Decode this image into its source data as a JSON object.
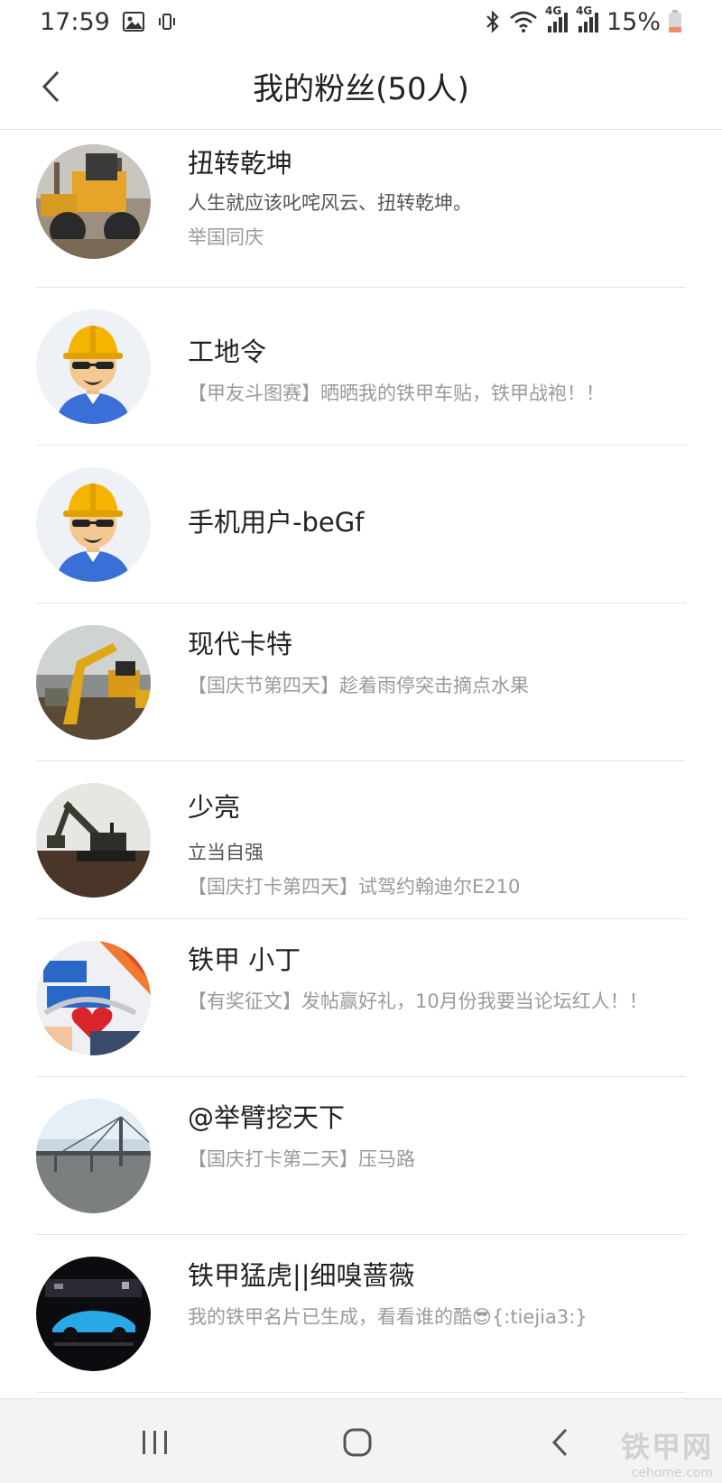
{
  "status_bar": {
    "time": "17:59",
    "network_left": "4G",
    "network_right": "4G",
    "battery": "15%",
    "icons": [
      "image-icon",
      "vibrate-icon",
      "bluetooth-icon",
      "wifi-icon",
      "signal-icon",
      "battery-icon"
    ]
  },
  "header": {
    "title": "我的粉丝(50人)",
    "back_icon": "chevron-left-icon"
  },
  "fans": [
    {
      "name": "扭转乾坤",
      "bio": "人生就应该叱咤风云、扭转乾坤。",
      "post": "举国同庆",
      "avatar": "photo-wheel-loader"
    },
    {
      "name": "工地令",
      "bio": "",
      "post": "【甲友斗图赛】晒晒我的铁甲车贴，铁甲战袍！！",
      "avatar": "default-worker"
    },
    {
      "name": "手机用户-beGf",
      "bio": "",
      "post": "",
      "avatar": "default-worker"
    },
    {
      "name": "现代卡特",
      "bio": "",
      "post": "【国庆节第四天】趁着雨停突击摘点水果",
      "avatar": "photo-excavator"
    },
    {
      "name": "少亮",
      "bio": "立当自强",
      "post": "【国庆打卡第四天】试驾约翰迪尔E210",
      "avatar": "photo-excavator-dusk"
    },
    {
      "name": "铁甲 小丁",
      "bio": "",
      "post": "【有奖征文】发帖赢好礼，10月份我要当论坛红人！！",
      "avatar": "photo-badge"
    },
    {
      "name": "@举臂挖天下",
      "bio": "",
      "post": "【国庆打卡第二天】压马路",
      "avatar": "photo-bridge"
    },
    {
      "name": "铁甲猛虎||细嗅蔷薇",
      "bio": "",
      "post": "我的铁甲名片已生成，看看谁的酷😎{:tiejia3:}",
      "avatar": "photo-car"
    }
  ],
  "nav_bar": {
    "recents_icon": "recents-icon",
    "home_icon": "home-icon",
    "back_icon": "back-icon",
    "watermark_main": "铁甲网",
    "watermark_sub": "cehome.com"
  },
  "colors": {
    "title": "#222222",
    "bio": "#555555",
    "post": "#9a9a9a",
    "divider": "#e6e6e6",
    "nav_bg": "#f3f3f3",
    "helmet": "#f5b400",
    "shirt": "#3b6fd8"
  }
}
